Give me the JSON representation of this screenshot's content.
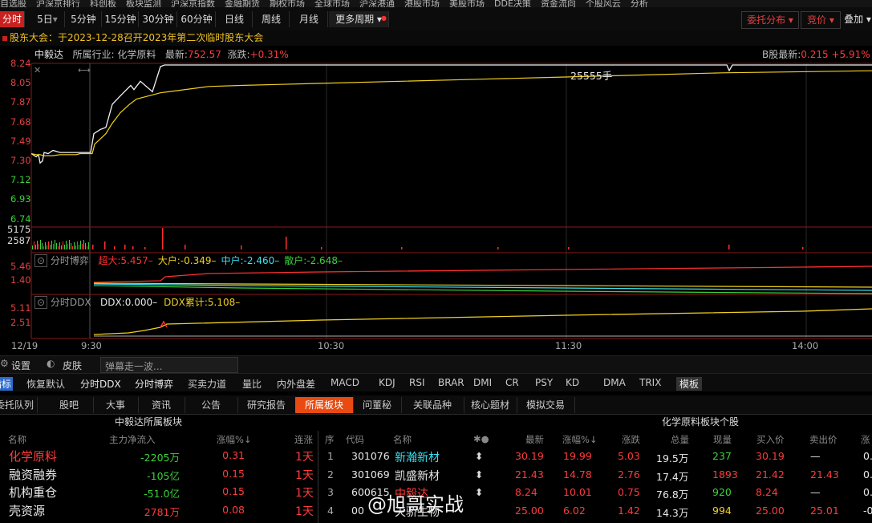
{
  "top_nav": [
    "自选股",
    "沪深京排行",
    "科创板",
    "板块监测",
    "沪深京指数",
    "金融期货",
    "期权市场",
    "全球市场",
    "沪深港通",
    "港股市场",
    "美股市场",
    "DDE决策",
    "资金流向",
    "个股风云",
    "分析"
  ],
  "periods": [
    {
      "label": "分时",
      "active": true
    },
    {
      "label": "5日",
      "arrow": "▾"
    },
    {
      "label": "5分钟"
    },
    {
      "label": "15分钟"
    },
    {
      "label": "30分钟"
    },
    {
      "label": "60分钟"
    },
    {
      "label": "日线"
    },
    {
      "label": "周线"
    },
    {
      "label": "月线"
    },
    {
      "label": "更多周期 ▾"
    }
  ],
  "right_buttons": {
    "entrust": "委托分布 ▾",
    "auction": "竞价 ▾",
    "overlay": "叠加 ▾"
  },
  "notice": "股东大会：于2023-12-28召开2023年第二次临时股东大会",
  "stock": {
    "name": "中毅达",
    "industry_label": "所属行业:",
    "industry": "化学原料",
    "latest_label": "最新:",
    "latest": "752.57",
    "change_label": "涨跌:",
    "change": "+0.31%",
    "b_share_label": "B股最新:",
    "b_share_price": "0.215",
    "b_share_change": "+5.91%"
  },
  "price_axis": [
    "8.24",
    "8.05",
    "7.87",
    "7.68",
    "7.49",
    "7.30",
    "7.12",
    "6.93",
    "6.74"
  ],
  "volume_axis": [
    "5175",
    "2587"
  ],
  "big_trade_label": "25555手",
  "fund_game": {
    "title": "分时博弈",
    "axis": [
      "5.46",
      "1.40"
    ],
    "items": [
      {
        "label": "超大:",
        "value": "5.457",
        "color": "#ff3030"
      },
      {
        "label": "大户:",
        "value": "-0.349",
        "color": "#f0d020"
      },
      {
        "label": "中户:",
        "value": "-2.460",
        "color": "#3ce0f0"
      },
      {
        "label": "散户:",
        "value": "-2.648",
        "color": "#3ad23a"
      }
    ]
  },
  "ddx": {
    "title": "分时DDX",
    "axis": [
      "5.11",
      "2.51"
    ],
    "items": [
      {
        "label": "DDX:",
        "value": "0.000",
        "color": "#e8e8e8"
      },
      {
        "label": "DDX累计:",
        "value": "5.108",
        "color": "#f0d020"
      }
    ]
  },
  "time_axis": {
    "date": "12/19",
    "times": [
      "9:30",
      "10:30",
      "11:30",
      "14:00"
    ]
  },
  "tool_bar": {
    "settings": "设置",
    "skin": "皮肤",
    "danmu_placeholder": "弹幕走一波..."
  },
  "indicators": [
    "指标",
    "恢复默认",
    "分时DDX",
    "分时博弈",
    "买卖力道",
    "量比",
    "内外盘差",
    "MACD",
    "KDJ",
    "RSI",
    "BRAR",
    "DMI",
    "CR",
    "PSY",
    "KD",
    "DMA",
    "TRIX",
    "模板"
  ],
  "info_tabs": [
    {
      "label": "委托队列"
    },
    {
      "label": "股吧"
    },
    {
      "label": "大事"
    },
    {
      "label": "资讯"
    },
    {
      "label": "公告"
    },
    {
      "label": "研究报告"
    },
    {
      "label": "所属板块",
      "active": true
    },
    {
      "label": "问董秘"
    },
    {
      "label": "关联品种"
    },
    {
      "label": "核心题材"
    },
    {
      "label": "模拟交易"
    }
  ],
  "left_panel": {
    "title": "中毅达所属板块",
    "headers": [
      "名称",
      "主力净流入",
      "涨幅%↓",
      "连涨"
    ],
    "rows": [
      {
        "name": "化学原料",
        "inflow": "-2205万",
        "pct": "0.31",
        "streak": "1天"
      },
      {
        "name": "融资融券",
        "inflow": "-105亿",
        "pct": "0.15",
        "streak": "1天"
      },
      {
        "name": "机构重仓",
        "inflow": "-51.0亿",
        "pct": "0.15",
        "streak": "1天"
      },
      {
        "name": "壳资源",
        "inflow": "2781万",
        "pct": "0.08",
        "streak": "1天"
      }
    ]
  },
  "right_panel": {
    "title": "化学原料板块个股",
    "headers": [
      "序",
      "代码",
      "名称",
      "✱●",
      "最新",
      "涨幅%↓",
      "涨跌",
      "总量",
      "现量",
      "买入价",
      "卖出价",
      "涨"
    ],
    "rows": [
      {
        "idx": "1",
        "code": "301076",
        "name": "新瀚新材",
        "mark": "⬍",
        "last": "30.19",
        "pct": "19.99",
        "chg": "5.03",
        "vol": "19.5万",
        "cur": "237",
        "bid": "30.19",
        "ask": "—",
        "tail": "0."
      },
      {
        "idx": "2",
        "code": "301069",
        "name": "凯盛新材",
        "mark": "⬍",
        "last": "21.43",
        "pct": "14.78",
        "chg": "2.76",
        "vol": "17.4万",
        "cur": "1893",
        "bid": "21.42",
        "ask": "21.43",
        "tail": "0."
      },
      {
        "idx": "3",
        "code": "600615",
        "name": "中毅达",
        "mark": "⬍",
        "last": "8.24",
        "pct": "10.01",
        "chg": "0.75",
        "vol": "76.8万",
        "cur": "920",
        "bid": "8.24",
        "ask": "—",
        "tail": "0."
      },
      {
        "idx": "4",
        "code": "00",
        "name": "天骄生物",
        "mark": "",
        "last": "25.00",
        "pct": "6.02",
        "chg": "1.42",
        "vol": "14.3万",
        "cur": "994",
        "bid": "25.00",
        "ask": "25.01",
        "tail": "-0."
      }
    ]
  },
  "watermark": "@旭哥实战",
  "chart_data": {
    "type": "line",
    "price_series": {
      "name": "价格",
      "values": [
        7.41,
        7.38,
        7.4,
        7.32,
        7.34,
        7.42,
        7.41,
        7.44,
        7.42,
        7.42,
        7.42,
        7.42,
        7.42,
        7.42,
        7.42,
        7.42,
        7.42,
        7.42,
        7.6,
        7.64,
        7.66,
        7.88,
        7.96,
        8.0,
        8.06,
        8.02,
        8.1,
        8.0,
        8.24
      ]
    },
    "avg_series": {
      "name": "均价",
      "values": [
        7.41,
        7.4,
        7.4,
        7.39,
        7.39,
        7.39,
        7.4,
        7.4,
        7.4,
        7.41,
        7.41,
        7.41,
        7.41,
        7.41,
        7.41,
        7.41,
        7.41,
        7.41,
        7.5,
        7.55,
        7.6,
        7.7,
        7.8,
        7.87,
        7.93,
        7.95,
        7.97,
        7.99,
        8.0,
        8.05,
        8.06,
        8.07,
        8.08,
        8.1,
        8.12,
        8.14,
        8.16,
        8.18,
        8.2
      ]
    },
    "ylim": [
      6.74,
      8.24
    ]
  }
}
